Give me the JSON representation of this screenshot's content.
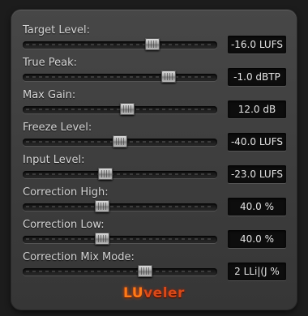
{
  "window": {
    "title": "LUveler"
  },
  "logo": {
    "part1": "LU",
    "part2": "veler"
  },
  "params": [
    {
      "id": "target-level",
      "label": "Target Level:",
      "value": "-16.0 LUFS",
      "slider_position": 0.68
    },
    {
      "id": "true-peak",
      "label": "True Peak:",
      "value": "-1.0 dBTP",
      "slider_position": 0.77
    },
    {
      "id": "max-gain",
      "label": "Max Gain:",
      "value": "12.0 dB",
      "slider_position": 0.54
    },
    {
      "id": "freeze-level",
      "label": "Freeze Level:",
      "value": "-40.0 LUFS",
      "slider_position": 0.5
    },
    {
      "id": "input-level",
      "label": "Input Level:",
      "value": "-23.0 LUFS",
      "slider_position": 0.42
    },
    {
      "id": "correction-high",
      "label": "Correction High:",
      "value": "40.0 %",
      "slider_position": 0.4
    },
    {
      "id": "correction-low",
      "label": "Correction Low:",
      "value": "40.0 %",
      "slider_position": 0.4
    },
    {
      "id": "correction-mix-mode",
      "label": "Correction Mix Mode:",
      "value": "2 LLi|(J %",
      "slider_position": 0.64
    }
  ]
}
